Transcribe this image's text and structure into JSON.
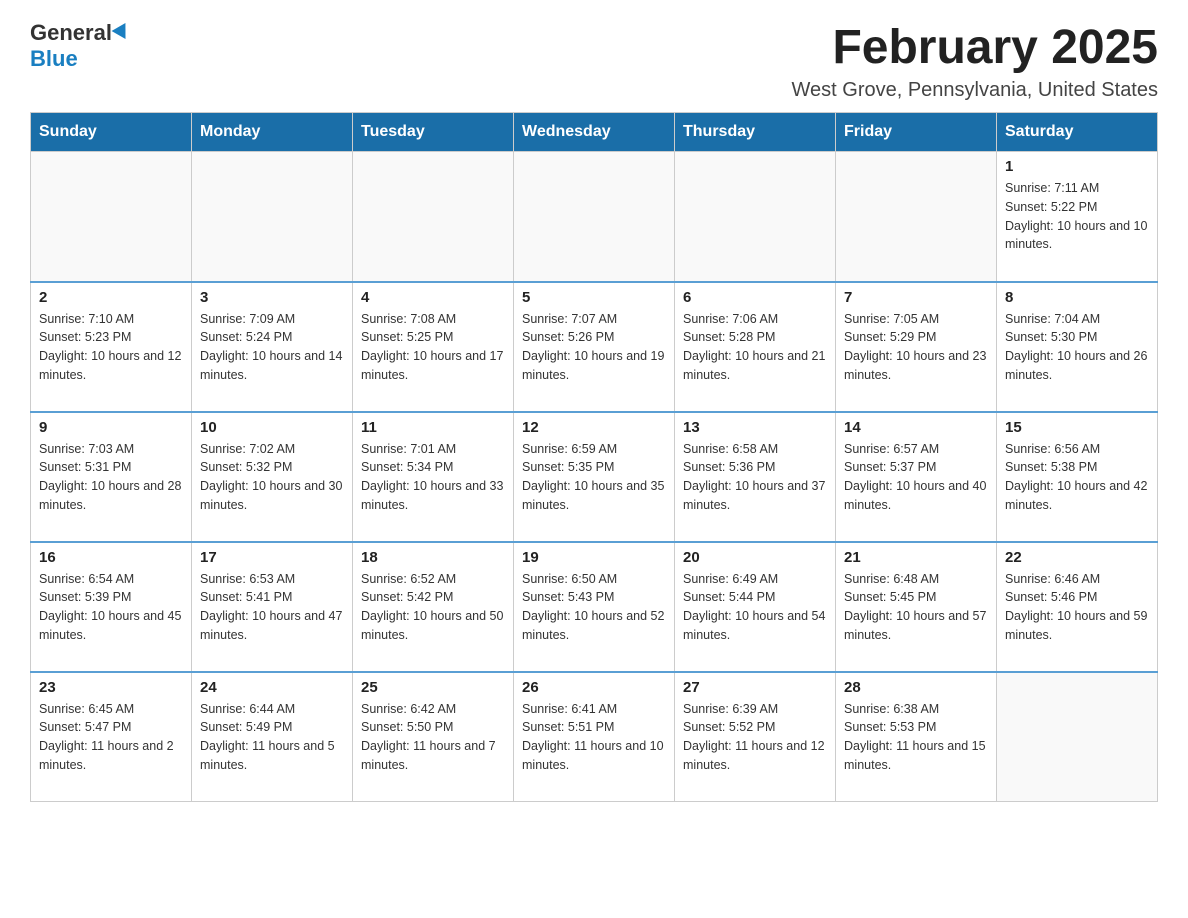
{
  "header": {
    "logo_general": "General",
    "logo_blue": "Blue",
    "title": "February 2025",
    "subtitle": "West Grove, Pennsylvania, United States"
  },
  "days_of_week": [
    "Sunday",
    "Monday",
    "Tuesday",
    "Wednesday",
    "Thursday",
    "Friday",
    "Saturday"
  ],
  "weeks": [
    [
      {
        "day": "",
        "sunrise": "",
        "sunset": "",
        "daylight": ""
      },
      {
        "day": "",
        "sunrise": "",
        "sunset": "",
        "daylight": ""
      },
      {
        "day": "",
        "sunrise": "",
        "sunset": "",
        "daylight": ""
      },
      {
        "day": "",
        "sunrise": "",
        "sunset": "",
        "daylight": ""
      },
      {
        "day": "",
        "sunrise": "",
        "sunset": "",
        "daylight": ""
      },
      {
        "day": "",
        "sunrise": "",
        "sunset": "",
        "daylight": ""
      },
      {
        "day": "1",
        "sunrise": "Sunrise: 7:11 AM",
        "sunset": "Sunset: 5:22 PM",
        "daylight": "Daylight: 10 hours and 10 minutes."
      }
    ],
    [
      {
        "day": "2",
        "sunrise": "Sunrise: 7:10 AM",
        "sunset": "Sunset: 5:23 PM",
        "daylight": "Daylight: 10 hours and 12 minutes."
      },
      {
        "day": "3",
        "sunrise": "Sunrise: 7:09 AM",
        "sunset": "Sunset: 5:24 PM",
        "daylight": "Daylight: 10 hours and 14 minutes."
      },
      {
        "day": "4",
        "sunrise": "Sunrise: 7:08 AM",
        "sunset": "Sunset: 5:25 PM",
        "daylight": "Daylight: 10 hours and 17 minutes."
      },
      {
        "day": "5",
        "sunrise": "Sunrise: 7:07 AM",
        "sunset": "Sunset: 5:26 PM",
        "daylight": "Daylight: 10 hours and 19 minutes."
      },
      {
        "day": "6",
        "sunrise": "Sunrise: 7:06 AM",
        "sunset": "Sunset: 5:28 PM",
        "daylight": "Daylight: 10 hours and 21 minutes."
      },
      {
        "day": "7",
        "sunrise": "Sunrise: 7:05 AM",
        "sunset": "Sunset: 5:29 PM",
        "daylight": "Daylight: 10 hours and 23 minutes."
      },
      {
        "day": "8",
        "sunrise": "Sunrise: 7:04 AM",
        "sunset": "Sunset: 5:30 PM",
        "daylight": "Daylight: 10 hours and 26 minutes."
      }
    ],
    [
      {
        "day": "9",
        "sunrise": "Sunrise: 7:03 AM",
        "sunset": "Sunset: 5:31 PM",
        "daylight": "Daylight: 10 hours and 28 minutes."
      },
      {
        "day": "10",
        "sunrise": "Sunrise: 7:02 AM",
        "sunset": "Sunset: 5:32 PM",
        "daylight": "Daylight: 10 hours and 30 minutes."
      },
      {
        "day": "11",
        "sunrise": "Sunrise: 7:01 AM",
        "sunset": "Sunset: 5:34 PM",
        "daylight": "Daylight: 10 hours and 33 minutes."
      },
      {
        "day": "12",
        "sunrise": "Sunrise: 6:59 AM",
        "sunset": "Sunset: 5:35 PM",
        "daylight": "Daylight: 10 hours and 35 minutes."
      },
      {
        "day": "13",
        "sunrise": "Sunrise: 6:58 AM",
        "sunset": "Sunset: 5:36 PM",
        "daylight": "Daylight: 10 hours and 37 minutes."
      },
      {
        "day": "14",
        "sunrise": "Sunrise: 6:57 AM",
        "sunset": "Sunset: 5:37 PM",
        "daylight": "Daylight: 10 hours and 40 minutes."
      },
      {
        "day": "15",
        "sunrise": "Sunrise: 6:56 AM",
        "sunset": "Sunset: 5:38 PM",
        "daylight": "Daylight: 10 hours and 42 minutes."
      }
    ],
    [
      {
        "day": "16",
        "sunrise": "Sunrise: 6:54 AM",
        "sunset": "Sunset: 5:39 PM",
        "daylight": "Daylight: 10 hours and 45 minutes."
      },
      {
        "day": "17",
        "sunrise": "Sunrise: 6:53 AM",
        "sunset": "Sunset: 5:41 PM",
        "daylight": "Daylight: 10 hours and 47 minutes."
      },
      {
        "day": "18",
        "sunrise": "Sunrise: 6:52 AM",
        "sunset": "Sunset: 5:42 PM",
        "daylight": "Daylight: 10 hours and 50 minutes."
      },
      {
        "day": "19",
        "sunrise": "Sunrise: 6:50 AM",
        "sunset": "Sunset: 5:43 PM",
        "daylight": "Daylight: 10 hours and 52 minutes."
      },
      {
        "day": "20",
        "sunrise": "Sunrise: 6:49 AM",
        "sunset": "Sunset: 5:44 PM",
        "daylight": "Daylight: 10 hours and 54 minutes."
      },
      {
        "day": "21",
        "sunrise": "Sunrise: 6:48 AM",
        "sunset": "Sunset: 5:45 PM",
        "daylight": "Daylight: 10 hours and 57 minutes."
      },
      {
        "day": "22",
        "sunrise": "Sunrise: 6:46 AM",
        "sunset": "Sunset: 5:46 PM",
        "daylight": "Daylight: 10 hours and 59 minutes."
      }
    ],
    [
      {
        "day": "23",
        "sunrise": "Sunrise: 6:45 AM",
        "sunset": "Sunset: 5:47 PM",
        "daylight": "Daylight: 11 hours and 2 minutes."
      },
      {
        "day": "24",
        "sunrise": "Sunrise: 6:44 AM",
        "sunset": "Sunset: 5:49 PM",
        "daylight": "Daylight: 11 hours and 5 minutes."
      },
      {
        "day": "25",
        "sunrise": "Sunrise: 6:42 AM",
        "sunset": "Sunset: 5:50 PM",
        "daylight": "Daylight: 11 hours and 7 minutes."
      },
      {
        "day": "26",
        "sunrise": "Sunrise: 6:41 AM",
        "sunset": "Sunset: 5:51 PM",
        "daylight": "Daylight: 11 hours and 10 minutes."
      },
      {
        "day": "27",
        "sunrise": "Sunrise: 6:39 AM",
        "sunset": "Sunset: 5:52 PM",
        "daylight": "Daylight: 11 hours and 12 minutes."
      },
      {
        "day": "28",
        "sunrise": "Sunrise: 6:38 AM",
        "sunset": "Sunset: 5:53 PM",
        "daylight": "Daylight: 11 hours and 15 minutes."
      },
      {
        "day": "",
        "sunrise": "",
        "sunset": "",
        "daylight": ""
      }
    ]
  ]
}
